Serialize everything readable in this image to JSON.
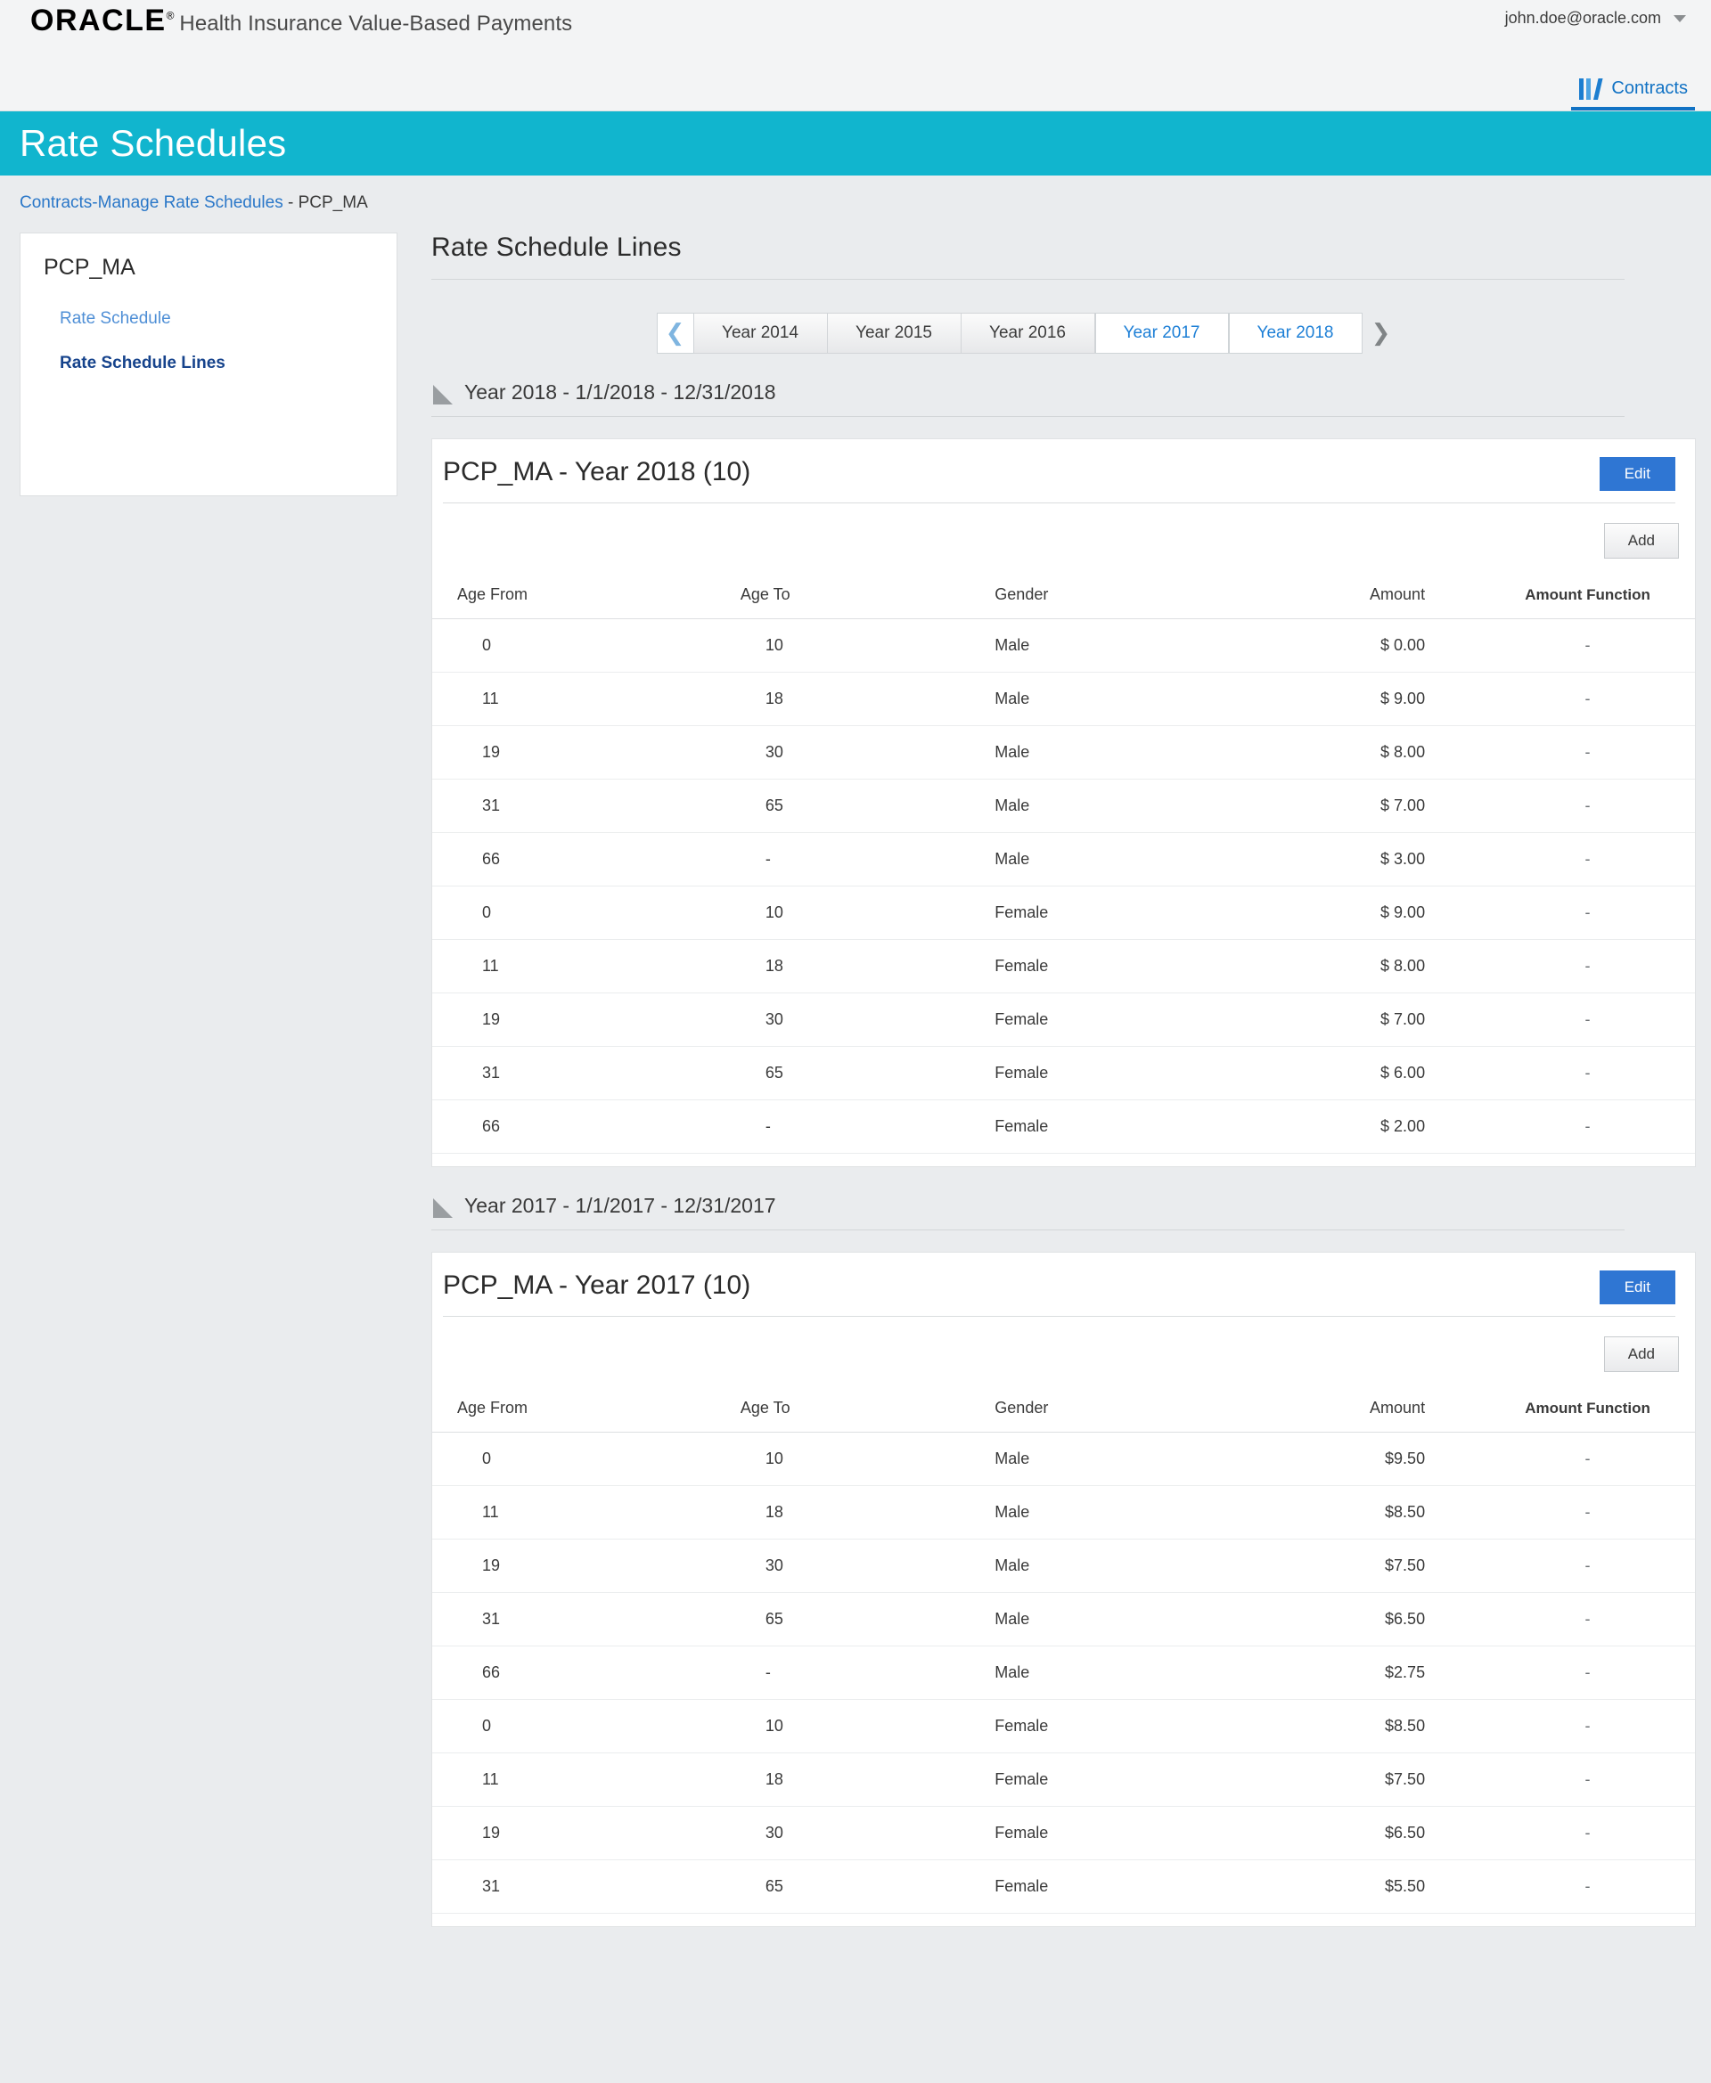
{
  "header": {
    "logo_text": "ORACLE",
    "logo_registered": "®",
    "app_name": "Health Insurance Value-Based Payments",
    "user_email": "john.doe@oracle.com",
    "user_caret_icon": "chevron-down-icon",
    "nav_tab_label": "Contracts",
    "nav_tab_icon": "books-icon",
    "accent_teal": "#11b5ce",
    "accent_blue": "#2f76d3"
  },
  "title_band": {
    "page_title": "Rate Schedules"
  },
  "breadcrumb": {
    "link_text": "Contracts-Manage Rate Schedules",
    "separator": " - ",
    "current": "PCP_MA"
  },
  "side_panel": {
    "title": "PCP_MA",
    "links": [
      {
        "label": "Rate Schedule",
        "active": false
      },
      {
        "label": "Rate Schedule Lines",
        "active": true
      }
    ]
  },
  "main": {
    "heading": "Rate Schedule Lines",
    "year_strip": {
      "prev_icon": "chevron-left-icon",
      "next_icon": "chevron-right-icon",
      "tabs": [
        {
          "label": "Year 2014",
          "selected": false
        },
        {
          "label": "Year 2015",
          "selected": false
        },
        {
          "label": "Year 2016",
          "selected": false
        },
        {
          "label": "Year 2017",
          "selected": true
        },
        {
          "label": "Year 2018",
          "selected": true
        }
      ]
    },
    "table_columns": [
      "Age From",
      "Age To",
      "Gender",
      "Amount",
      "Amount Function"
    ],
    "buttons": {
      "edit": "Edit",
      "add": "Add"
    },
    "sections": [
      {
        "section_label": "Year 2018 - 1/1/2018 - 12/31/2018",
        "card_title": "PCP_MA - Year 2018",
        "card_count": "(10)",
        "rows": [
          {
            "age_from": "0",
            "age_to": "10",
            "gender": "Male",
            "amount": "$ 0.00",
            "amount_function": "-"
          },
          {
            "age_from": "11",
            "age_to": "18",
            "gender": "Male",
            "amount": "$ 9.00",
            "amount_function": "-"
          },
          {
            "age_from": "19",
            "age_to": "30",
            "gender": "Male",
            "amount": "$ 8.00",
            "amount_function": "-"
          },
          {
            "age_from": "31",
            "age_to": "65",
            "gender": "Male",
            "amount": "$ 7.00",
            "amount_function": "-"
          },
          {
            "age_from": "66",
            "age_to": "-",
            "gender": "Male",
            "amount": "$ 3.00",
            "amount_function": "-"
          },
          {
            "age_from": "0",
            "age_to": "10",
            "gender": "Female",
            "amount": "$ 9.00",
            "amount_function": "-"
          },
          {
            "age_from": "11",
            "age_to": "18",
            "gender": "Female",
            "amount": "$ 8.00",
            "amount_function": "-"
          },
          {
            "age_from": "19",
            "age_to": "30",
            "gender": "Female",
            "amount": "$ 7.00",
            "amount_function": "-"
          },
          {
            "age_from": "31",
            "age_to": "65",
            "gender": "Female",
            "amount": "$ 6.00",
            "amount_function": "-"
          },
          {
            "age_from": "66",
            "age_to": "-",
            "gender": "Female",
            "amount": "$ 2.00",
            "amount_function": "-"
          }
        ]
      },
      {
        "section_label": "Year 2017 - 1/1/2017 - 12/31/2017",
        "card_title": "PCP_MA - Year 2017",
        "card_count": "(10)",
        "rows": [
          {
            "age_from": "0",
            "age_to": "10",
            "gender": "Male",
            "amount": "$9.50",
            "amount_function": "-"
          },
          {
            "age_from": "11",
            "age_to": "18",
            "gender": "Male",
            "amount": "$8.50",
            "amount_function": "-"
          },
          {
            "age_from": "19",
            "age_to": "30",
            "gender": "Male",
            "amount": "$7.50",
            "amount_function": "-"
          },
          {
            "age_from": "31",
            "age_to": "65",
            "gender": "Male",
            "amount": "$6.50",
            "amount_function": "-"
          },
          {
            "age_from": "66",
            "age_to": "-",
            "gender": "Male",
            "amount": "$2.75",
            "amount_function": "-"
          },
          {
            "age_from": "0",
            "age_to": "10",
            "gender": "Female",
            "amount": "$8.50",
            "amount_function": "-"
          },
          {
            "age_from": "11",
            "age_to": "18",
            "gender": "Female",
            "amount": "$7.50",
            "amount_function": "-"
          },
          {
            "age_from": "19",
            "age_to": "30",
            "gender": "Female",
            "amount": "$6.50",
            "amount_function": "-"
          },
          {
            "age_from": "31",
            "age_to": "65",
            "gender": "Female",
            "amount": "$5.50",
            "amount_function": "-"
          }
        ]
      }
    ]
  }
}
